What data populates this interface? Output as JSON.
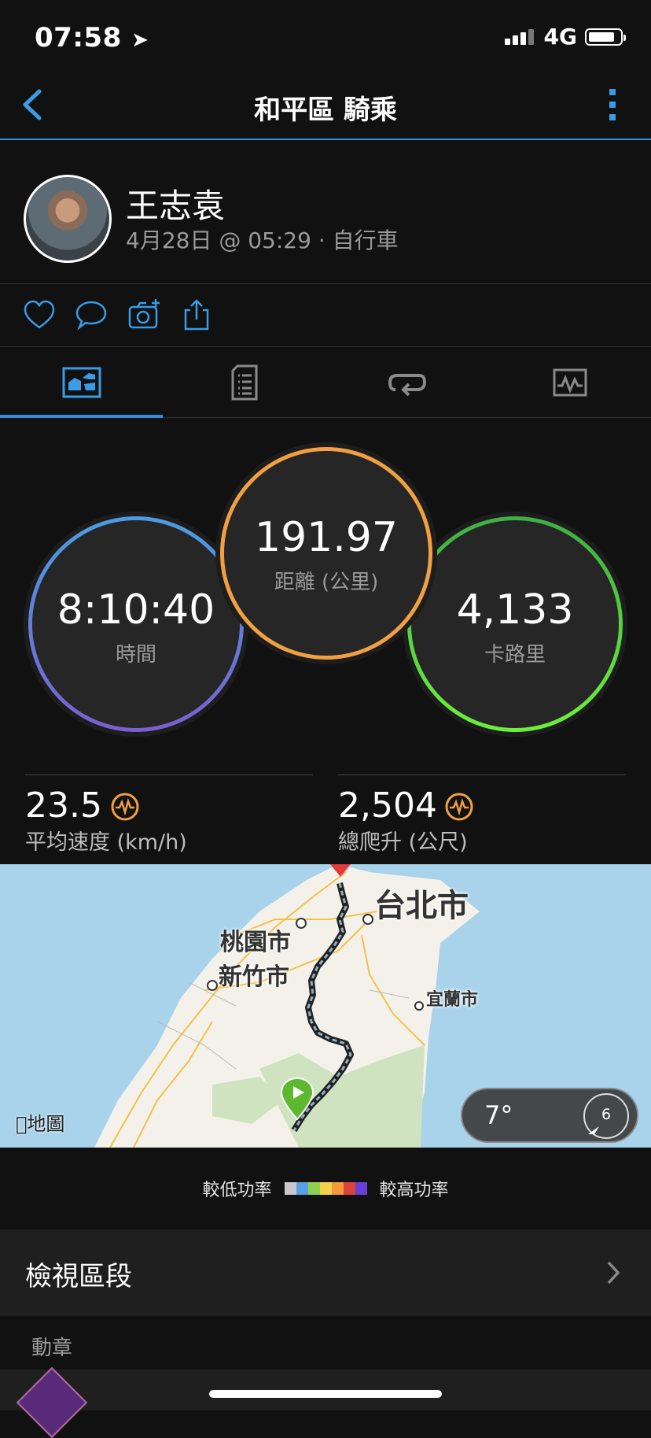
{
  "status_bar": {
    "time": "07:58",
    "network": "4G"
  },
  "nav": {
    "title": "和平區 騎乘"
  },
  "profile": {
    "name": "王志袁",
    "meta": "4月28日 @ 05:29 · 自行車"
  },
  "stats": {
    "time": {
      "value": "8:10:40",
      "label": "時間"
    },
    "distance": {
      "value": "191.97",
      "label": "距離 (公里)"
    },
    "calories": {
      "value": "4,133",
      "label": "卡路里"
    },
    "avg_speed": {
      "value": "23.5",
      "label": "平均速度 (km/h)"
    },
    "total_ascent": {
      "value": "2,504",
      "label": "總爬升 (公尺)"
    }
  },
  "map": {
    "labels": {
      "taipei": "台北市",
      "taoyuan": "桃園市",
      "hsinchu": "新竹市",
      "yilan": "宜蘭市"
    },
    "attribution": "地圖",
    "weather_temp": "7°",
    "wind_speed": "6"
  },
  "legend": {
    "low": "較低功率",
    "high": "較高功率",
    "colors": [
      "#c8c8c8",
      "#5aa0e8",
      "#8fd14f",
      "#f2d04b",
      "#f29a3a",
      "#d9443a",
      "#6a3fd8"
    ]
  },
  "segments": {
    "label": "檢視區段"
  },
  "badges": {
    "header": "動章"
  },
  "colors": {
    "accent": "#2f8fd8",
    "orange": "#f0a040",
    "green": "#5dd640",
    "blue": "#4a9de0"
  }
}
